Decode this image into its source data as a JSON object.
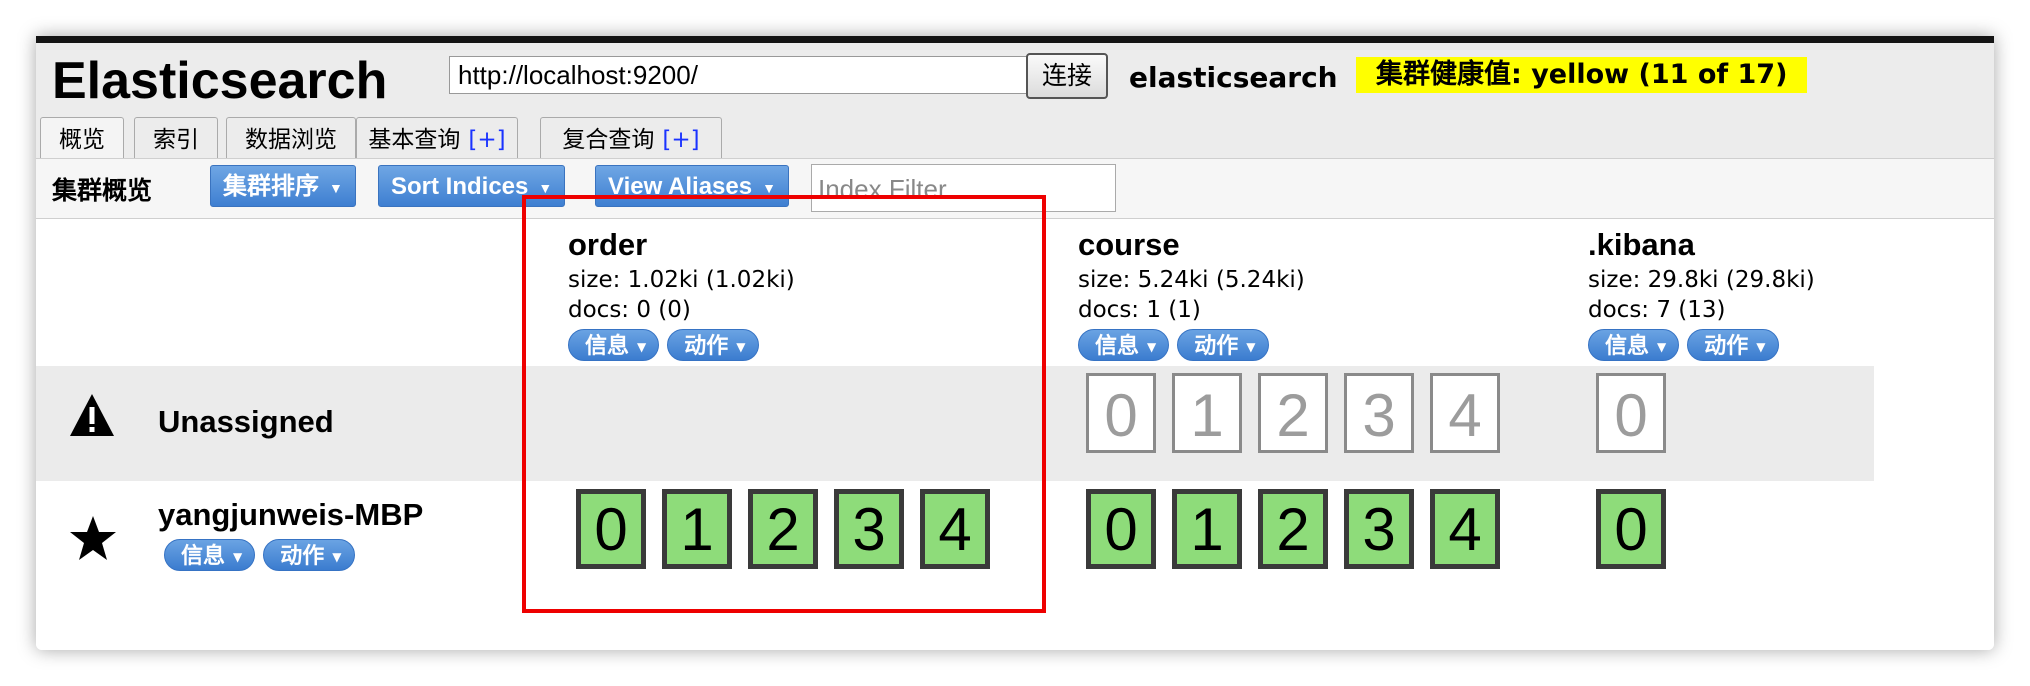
{
  "header": {
    "title": "Elasticsearch",
    "url_value": "http://localhost:9200/",
    "connect_label": "连接",
    "cluster_name": "elasticsearch",
    "health_text": "集群健康值: yellow (11 of 17)",
    "health_color": "#ffff00"
  },
  "tabs": [
    {
      "label": "概览",
      "plus": ""
    },
    {
      "label": "索引",
      "plus": ""
    },
    {
      "label": "数据浏览",
      "plus": ""
    },
    {
      "label": "基本查询",
      "plus": "[+]"
    },
    {
      "label": "复合查询",
      "plus": "[+]"
    }
  ],
  "toolbar": {
    "title": "集群概览",
    "sort_cluster_label": "集群排序",
    "sort_indices_label": "Sort Indices",
    "view_aliases_label": "View Aliases",
    "index_filter_placeholder": "Index Filter"
  },
  "indices": [
    {
      "name": "order",
      "size": "size: 1.02ki (1.02ki)",
      "docs": "docs: 0 (0)",
      "info_label": "信息",
      "action_label": "动作"
    },
    {
      "name": "course",
      "size": "size: 5.24ki (5.24ki)",
      "docs": "docs: 1 (1)",
      "info_label": "信息",
      "action_label": "动作"
    },
    {
      "name": ".kibana",
      "size": "size: 29.8ki (29.8ki)",
      "docs": "docs: 7 (13)",
      "info_label": "信息",
      "action_label": "动作"
    }
  ],
  "nodes": {
    "unassigned": {
      "name": "Unassigned",
      "icon": "warning-icon"
    },
    "node": {
      "name": "yangjunweis-MBP",
      "icon": "star-icon",
      "info_label": "信息",
      "action_label": "动作"
    }
  },
  "shards": {
    "unassigned_course": [
      "0",
      "1",
      "2",
      "3",
      "4"
    ],
    "unassigned_kibana": [
      "0"
    ],
    "node_order": [
      "0",
      "1",
      "2",
      "3",
      "4"
    ],
    "node_course": [
      "0",
      "1",
      "2",
      "3",
      "4"
    ],
    "node_kibana": [
      "0"
    ]
  },
  "colors": {
    "button_blue": "#3e7fd1",
    "shard_started": "#8edc7a",
    "highlight": "#ee0000"
  }
}
